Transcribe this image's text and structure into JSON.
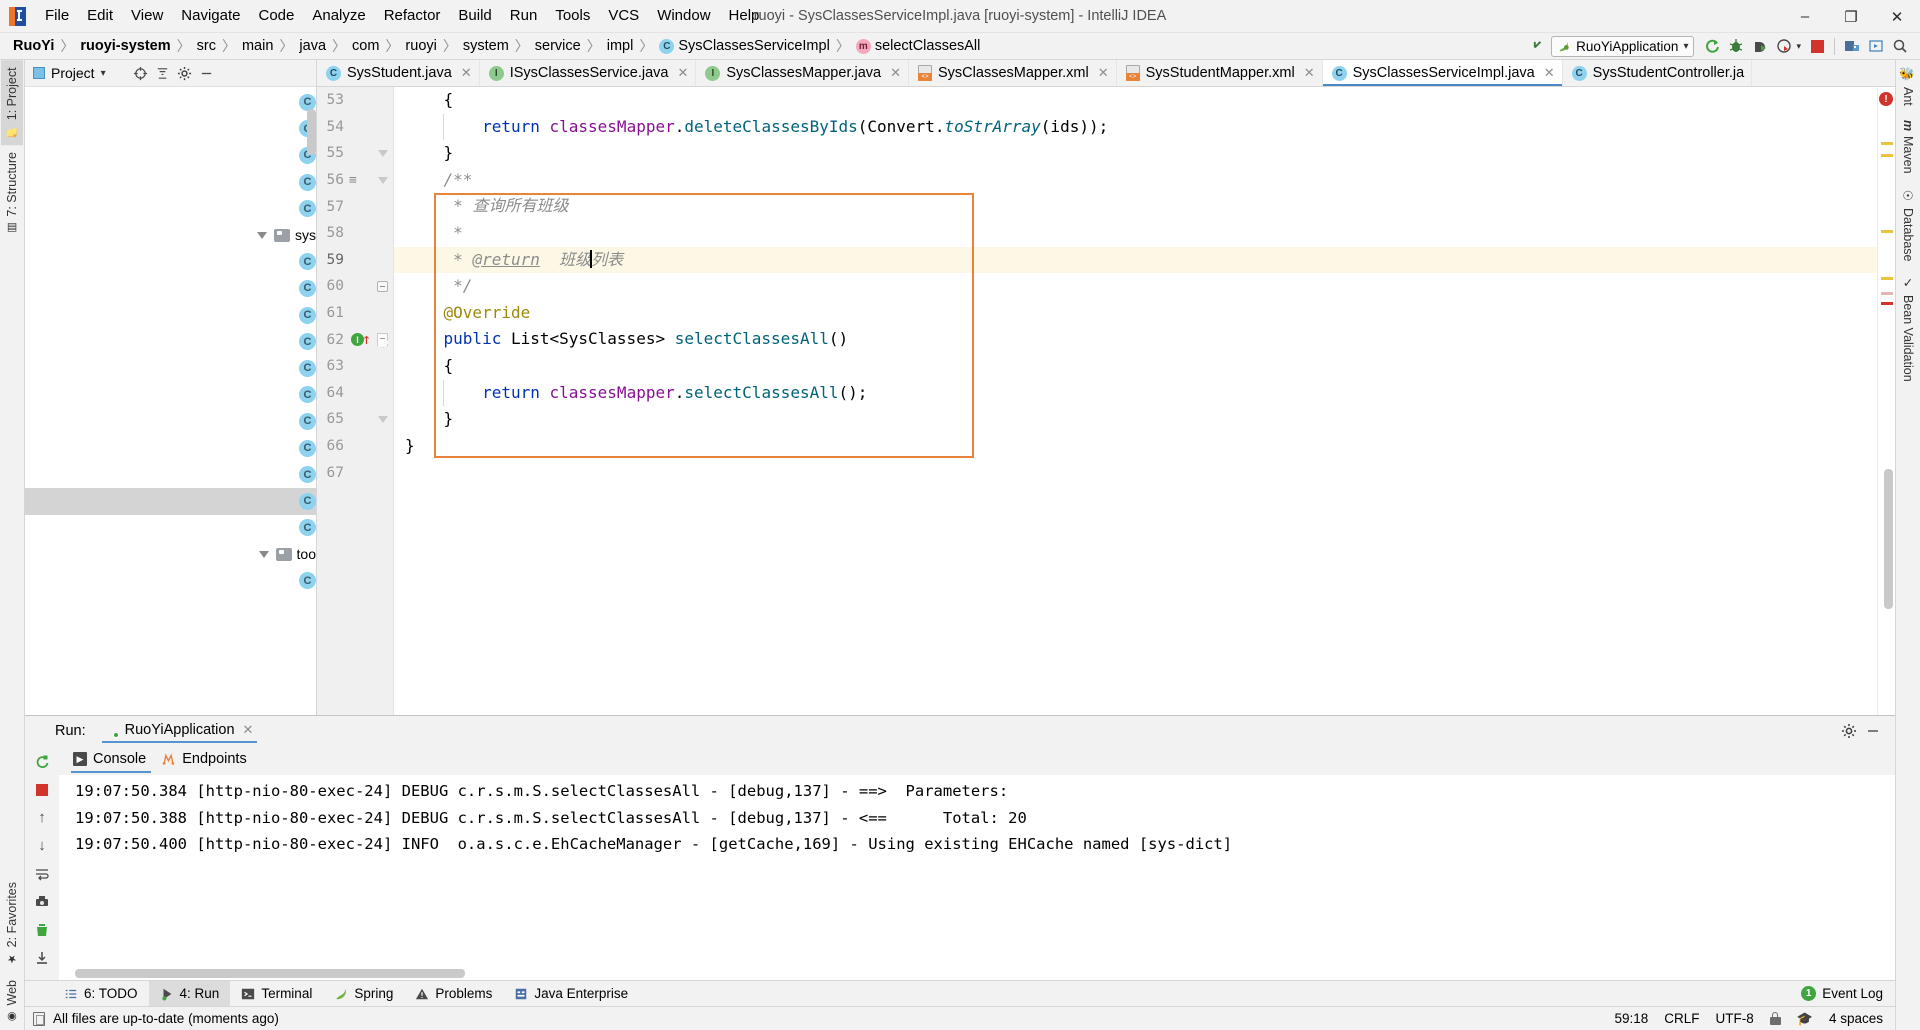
{
  "window": {
    "title": "ruoyi - SysClassesServiceImpl.java [ruoyi-system] - IntelliJ IDEA",
    "minimize": "–",
    "maximize": "❐",
    "close": "✕"
  },
  "menubar": {
    "items": [
      {
        "label": "File"
      },
      {
        "label": "Edit"
      },
      {
        "label": "View"
      },
      {
        "label": "Navigate"
      },
      {
        "label": "Code"
      },
      {
        "label": "Analyze"
      },
      {
        "label": "Refactor"
      },
      {
        "label": "Build"
      },
      {
        "label": "Run"
      },
      {
        "label": "Tools"
      },
      {
        "label": "VCS"
      },
      {
        "label": "Window"
      },
      {
        "label": "Help"
      }
    ]
  },
  "breadcrumb": {
    "items": [
      {
        "label": "RuoYi",
        "bold": true,
        "icon": ""
      },
      {
        "label": "ruoyi-system",
        "bold": true,
        "icon": ""
      },
      {
        "label": "src",
        "bold": false,
        "icon": ""
      },
      {
        "label": "main",
        "bold": false,
        "icon": ""
      },
      {
        "label": "java",
        "bold": false,
        "icon": ""
      },
      {
        "label": "com",
        "bold": false,
        "icon": ""
      },
      {
        "label": "ruoyi",
        "bold": false,
        "icon": ""
      },
      {
        "label": "system",
        "bold": false,
        "icon": ""
      },
      {
        "label": "service",
        "bold": false,
        "icon": ""
      },
      {
        "label": "impl",
        "bold": false,
        "icon": ""
      },
      {
        "label": "SysClassesServiceImpl",
        "bold": false,
        "icon": "class-icon",
        "glyph": "C"
      },
      {
        "label": "selectClassesAll",
        "bold": false,
        "icon": "method-icon",
        "glyph": "m"
      }
    ],
    "separator": "〉"
  },
  "toolbar": {
    "back_arrow_icon": "back-arrow-icon",
    "run_config": {
      "name": "RuoYiApplication",
      "dropdown": "▾"
    },
    "buttons": [
      {
        "name": "run-button",
        "glyph": "↻"
      },
      {
        "name": "debug-button",
        "glyph": "🐞"
      },
      {
        "name": "run-coverage-button",
        "glyph": "▶"
      },
      {
        "name": "profiler-button",
        "glyph": "◔"
      },
      {
        "name": "stop-button",
        "glyph": "■"
      },
      {
        "name": "project-structure-button",
        "glyph": "▤"
      },
      {
        "name": "update-project-button",
        "glyph": "▧"
      },
      {
        "name": "search-everywhere-button",
        "glyph": "🔍"
      }
    ]
  },
  "left_strip": {
    "top": [
      {
        "label": "1: Project",
        "active": true,
        "icon": "project-folder-icon"
      },
      {
        "label": "7: Structure",
        "active": false,
        "icon": "structure-icon"
      }
    ],
    "bottom": [
      {
        "label": "2: Favorites",
        "active": false,
        "icon": "star-icon"
      },
      {
        "label": "Web",
        "active": false,
        "icon": "web-icon"
      }
    ]
  },
  "right_strip": {
    "items": [
      {
        "label": "Ant",
        "icon": "ant-icon"
      },
      {
        "label": "Maven",
        "icon": "maven-icon"
      },
      {
        "label": "Database",
        "icon": "database-icon"
      },
      {
        "label": "Bean Validation",
        "icon": "bean-validation-icon"
      }
    ]
  },
  "project_panel": {
    "title": "Project",
    "dropdown": "▾",
    "buttons": [
      {
        "name": "locate-file-icon",
        "glyph": "⊕"
      },
      {
        "name": "collapse-all-icon",
        "glyph": "⤓"
      },
      {
        "name": "settings-gear-icon",
        "glyph": "⚙"
      },
      {
        "name": "hide-panel-icon",
        "glyph": "—"
      }
    ],
    "tree_rows": [
      {
        "type": "class",
        "glyph": "C",
        "label": ""
      },
      {
        "type": "class",
        "glyph": "C",
        "label": ""
      },
      {
        "type": "class",
        "glyph": "C",
        "label": ""
      },
      {
        "type": "class",
        "glyph": "C",
        "label": ""
      },
      {
        "type": "class",
        "glyph": "C",
        "label": ""
      },
      {
        "type": "folder",
        "glyph": "",
        "label": "sys",
        "expanded": true
      },
      {
        "type": "class",
        "glyph": "C",
        "label": ""
      },
      {
        "type": "class",
        "glyph": "C",
        "label": ""
      },
      {
        "type": "class",
        "glyph": "C",
        "label": ""
      },
      {
        "type": "class",
        "glyph": "C",
        "label": ""
      },
      {
        "type": "class",
        "glyph": "C",
        "label": ""
      },
      {
        "type": "class",
        "glyph": "C",
        "label": ""
      },
      {
        "type": "class",
        "glyph": "C",
        "label": ""
      },
      {
        "type": "class",
        "glyph": "C",
        "label": ""
      },
      {
        "type": "class",
        "glyph": "C",
        "label": ""
      },
      {
        "type": "class",
        "glyph": "C",
        "label": "",
        "selected": true
      },
      {
        "type": "class",
        "glyph": "C",
        "label": ""
      },
      {
        "type": "folder",
        "glyph": "",
        "label": "too",
        "expanded": true
      },
      {
        "type": "class",
        "glyph": "C",
        "label": ""
      }
    ]
  },
  "editor_tabs": [
    {
      "label": "SysStudent.java",
      "icon": "class-icon",
      "glyph": "C",
      "color": "#8dd2ef",
      "active": false,
      "close": "✕"
    },
    {
      "label": "ISysClassesService.java",
      "icon": "interface-icon",
      "glyph": "I",
      "color": "#8ec98e",
      "active": false,
      "close": "✕"
    },
    {
      "label": "SysClassesMapper.java",
      "icon": "interface-icon",
      "glyph": "I",
      "color": "#8ec98e",
      "active": false,
      "close": "✕"
    },
    {
      "label": "SysClassesMapper.xml",
      "icon": "xml-icon",
      "glyph": "",
      "color": "",
      "active": false,
      "close": "✕"
    },
    {
      "label": "SysStudentMapper.xml",
      "icon": "xml-icon",
      "glyph": "",
      "color": "",
      "active": false,
      "close": "✕"
    },
    {
      "label": "SysClassesServiceImpl.java",
      "icon": "class-icon",
      "glyph": "C",
      "color": "#8dd2ef",
      "active": true,
      "close": "✕"
    },
    {
      "label": "SysStudentController.ja",
      "icon": "class-icon",
      "glyph": "C",
      "color": "#8dd2ef",
      "active": false,
      "close": ""
    }
  ],
  "editor": {
    "first_line": 53,
    "lines": [
      {
        "num": 53,
        "tokens": [
          {
            "t": "    {",
            "c": ""
          }
        ],
        "fold": "",
        "current": false
      },
      {
        "num": 54,
        "tokens": [
          {
            "t": "        ",
            "c": ""
          },
          {
            "t": "return",
            "c": "kw"
          },
          {
            "t": " ",
            "c": ""
          },
          {
            "t": "classesMapper",
            "c": "fld"
          },
          {
            "t": ".",
            "c": ""
          },
          {
            "t": "deleteClassesByIds",
            "c": "mth"
          },
          {
            "t": "(Convert.",
            "c": ""
          },
          {
            "t": "toStrArray",
            "c": "stat-mth"
          },
          {
            "t": "(ids));",
            "c": ""
          }
        ],
        "fold": "",
        "current": false,
        "guide": true
      },
      {
        "num": 55,
        "tokens": [
          {
            "t": "    }",
            "c": ""
          }
        ],
        "fold": "fold-end",
        "current": false
      },
      {
        "num": 56,
        "tokens": [
          {
            "t": "    /**",
            "c": "cmt"
          }
        ],
        "fold": "fold-end",
        "current": false,
        "hamburger": true
      },
      {
        "num": 57,
        "tokens": [
          {
            "t": "     * ",
            "c": "cmt"
          },
          {
            "t": "查询所有班级",
            "c": "cmt"
          }
        ],
        "fold": "",
        "current": false
      },
      {
        "num": 58,
        "tokens": [
          {
            "t": "     *",
            "c": "cmt"
          }
        ],
        "fold": "",
        "current": false
      },
      {
        "num": 59,
        "tokens": [
          {
            "t": "     * ",
            "c": "cmt"
          },
          {
            "t": "@return",
            "c": "cmt-tag"
          },
          {
            "t": "  班级",
            "c": "cmt"
          },
          {
            "t": "|CARET|",
            "c": ""
          },
          {
            "t": "列表",
            "c": "cmt"
          }
        ],
        "fold": "",
        "current": true
      },
      {
        "num": 60,
        "tokens": [
          {
            "t": "     */",
            "c": "cmt"
          }
        ],
        "fold": "fold-minus",
        "current": false
      },
      {
        "num": 61,
        "tokens": [
          {
            "t": "    ",
            "c": ""
          },
          {
            "t": "@Override",
            "c": "anno"
          }
        ],
        "fold": "",
        "current": false
      },
      {
        "num": 62,
        "tokens": [
          {
            "t": "    ",
            "c": ""
          },
          {
            "t": "public",
            "c": "kw"
          },
          {
            "t": " List<SysClasses> ",
            "c": ""
          },
          {
            "t": "selectClassesAll",
            "c": "mth"
          },
          {
            "t": "()",
            "c": ""
          }
        ],
        "fold": "fold-shield",
        "current": false,
        "impl_marker": true
      },
      {
        "num": 63,
        "tokens": [
          {
            "t": "    {",
            "c": ""
          }
        ],
        "fold": "",
        "current": false
      },
      {
        "num": 64,
        "tokens": [
          {
            "t": "        ",
            "c": ""
          },
          {
            "t": "return",
            "c": "kw"
          },
          {
            "t": " ",
            "c": ""
          },
          {
            "t": "classesMapper",
            "c": "fld"
          },
          {
            "t": ".",
            "c": ""
          },
          {
            "t": "selectClassesAll",
            "c": "mth"
          },
          {
            "t": "();",
            "c": ""
          }
        ],
        "fold": "",
        "current": false,
        "guide": true
      },
      {
        "num": 65,
        "tokens": [
          {
            "t": "    }",
            "c": ""
          }
        ],
        "fold": "fold-end",
        "current": false
      },
      {
        "num": 66,
        "tokens": [
          {
            "t": "}",
            "c": ""
          }
        ],
        "fold": "",
        "current": false
      },
      {
        "num": 67,
        "tokens": [
          {
            "t": "",
            "c": ""
          }
        ],
        "fold": "",
        "current": false
      }
    ],
    "highlight_box": {
      "color": "#e8833a"
    },
    "error_count": "!"
  },
  "run_panel": {
    "label": "Run:",
    "config_name": "RuoYiApplication",
    "close": "✕",
    "settings_icon": "⚙",
    "hide_icon": "—",
    "tabs": [
      {
        "label": "Console",
        "icon": "console-icon",
        "active": true
      },
      {
        "label": "Endpoints",
        "icon": "endpoints-icon",
        "active": false
      }
    ],
    "toolbar_buttons": [
      {
        "name": "rerun-button",
        "glyph": "↻"
      },
      {
        "name": "stop-button",
        "glyph": "■"
      },
      {
        "name": "up-stacktrace-button",
        "glyph": "↑"
      },
      {
        "name": "down-stacktrace-button",
        "glyph": "↓"
      },
      {
        "name": "soft-wrap-button",
        "glyph": "↵"
      },
      {
        "name": "scroll-to-end-button",
        "glyph": "⇥"
      },
      {
        "name": "print-button",
        "glyph": "📷"
      },
      {
        "name": "clear-all-button",
        "glyph": "🗑"
      },
      {
        "name": "export-button",
        "glyph": "⤓"
      }
    ],
    "log_lines": [
      "19:07:50.384 [http-nio-80-exec-24] DEBUG c.r.s.m.S.selectClassesAll - [debug,137] - ==>  Parameters:",
      "19:07:50.388 [http-nio-80-exec-24] DEBUG c.r.s.m.S.selectClassesAll - [debug,137] - <==      Total: 20",
      "19:07:50.400 [http-nio-80-exec-24] INFO  o.a.s.c.e.EhCacheManager - [getCache,169] - Using existing EHCache named [sys-dict]"
    ]
  },
  "bottom_tabs": {
    "items": [
      {
        "label": "6: TODO",
        "icon": "todo-icon",
        "active": false
      },
      {
        "label": "4: Run",
        "icon": "run-icon",
        "active": true
      },
      {
        "label": "Terminal",
        "icon": "terminal-icon",
        "active": false
      },
      {
        "label": "Spring",
        "icon": "spring-icon",
        "active": false
      },
      {
        "label": "Problems",
        "icon": "warning-icon",
        "active": false
      },
      {
        "label": "Java Enterprise",
        "icon": "java-enterprise-icon",
        "active": false
      }
    ],
    "event_log": {
      "label": "Event Log",
      "count": "1"
    }
  },
  "statusbar": {
    "message": "All files are up-to-date (moments ago)",
    "position": "59:18",
    "line_separator": "CRLF",
    "encoding": "UTF-8",
    "lock_icon": "lock-icon",
    "hat_icon": "🎓",
    "indent": "4 spaces"
  }
}
